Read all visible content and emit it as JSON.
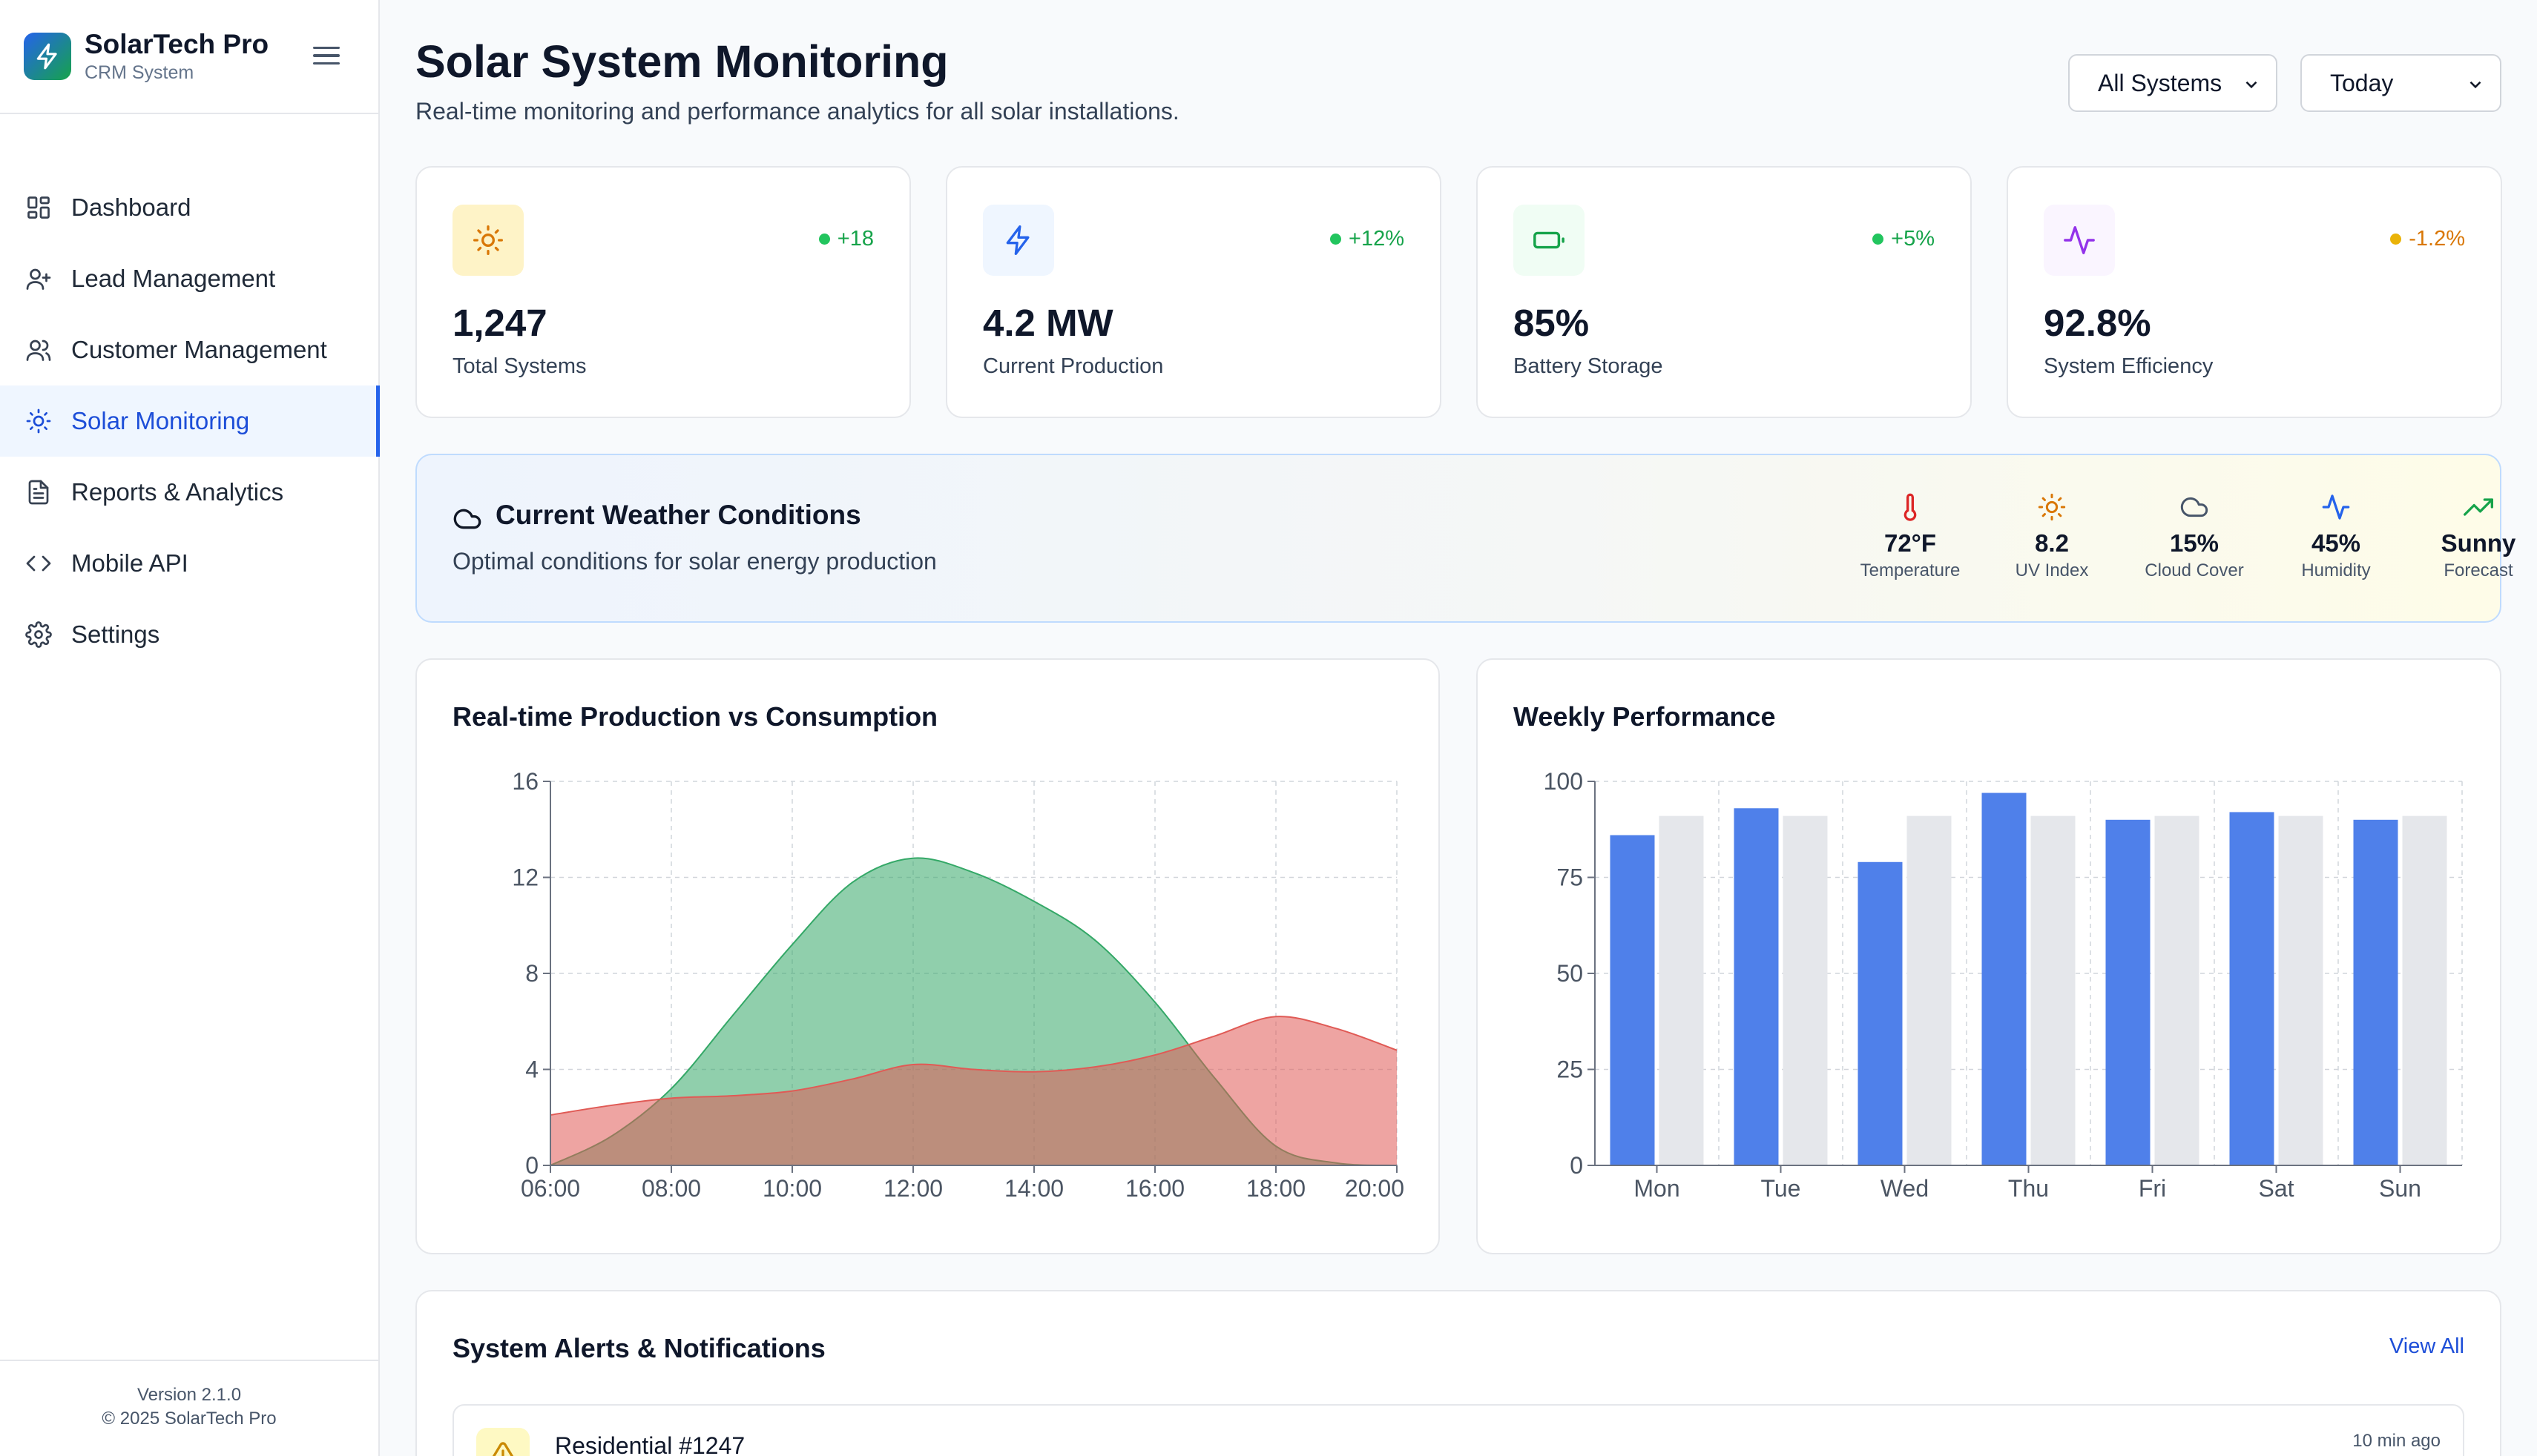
{
  "brand": {
    "name": "SolarTech Pro",
    "subtitle": "CRM System"
  },
  "sidebar": {
    "items": [
      {
        "label": "Dashboard",
        "icon": "dashboard-icon",
        "active": false
      },
      {
        "label": "Lead Management",
        "icon": "user-plus-icon",
        "active": false
      },
      {
        "label": "Customer Management",
        "icon": "users-icon",
        "active": false
      },
      {
        "label": "Solar Monitoring",
        "icon": "sun-icon",
        "active": true
      },
      {
        "label": "Reports & Analytics",
        "icon": "file-text-icon",
        "active": false
      },
      {
        "label": "Mobile API",
        "icon": "code-icon",
        "active": false
      },
      {
        "label": "Settings",
        "icon": "gear-icon",
        "active": false
      }
    ],
    "version": "Version 2.1.0",
    "copyright": "© 2025 SolarTech Pro"
  },
  "header": {
    "title": "Solar System Monitoring",
    "subtitle": "Real-time monitoring and performance analytics for all solar installations.",
    "system_filter": "All Systems",
    "time_filter": "Today"
  },
  "stats": [
    {
      "value": "1,247",
      "label": "Total Systems",
      "delta": "+18",
      "icon": "sun-icon",
      "accent": "#d97706",
      "delta_color": "#16a34a"
    },
    {
      "value": "4.2 MW",
      "label": "Current Production",
      "delta": "+12%",
      "icon": "lightning-icon",
      "accent": "#2563eb",
      "delta_color": "#16a34a"
    },
    {
      "value": "85%",
      "label": "Battery Storage",
      "delta": "+5%",
      "icon": "battery-icon",
      "accent": "#16a34a",
      "delta_color": "#16a34a"
    },
    {
      "value": "92.8%",
      "label": "System Efficiency",
      "delta": "-1.2%",
      "icon": "activity-icon",
      "accent": "#9333ea",
      "delta_color": "#d97706"
    }
  ],
  "weather": {
    "title": "Current Weather Conditions",
    "subtitle": "Optimal conditions for solar energy production",
    "metrics": [
      {
        "value": "72°F",
        "label": "Temperature",
        "icon": "thermometer-icon",
        "color": "#dc2626"
      },
      {
        "value": "8.2",
        "label": "UV Index",
        "icon": "sun-icon",
        "color": "#d97706"
      },
      {
        "value": "15%",
        "label": "Cloud Cover",
        "icon": "cloud-icon",
        "color": "#475569"
      },
      {
        "value": "45%",
        "label": "Humidity",
        "icon": "activity-icon",
        "color": "#2563eb"
      },
      {
        "value": "Sunny",
        "label": "Forecast",
        "icon": "trending-up-icon",
        "color": "#16a34a"
      }
    ]
  },
  "charts": {
    "production_title": "Real-time Production vs Consumption",
    "weekly_title": "Weekly Performance"
  },
  "chart_data": [
    {
      "type": "area",
      "title": "Real-time Production vs Consumption",
      "x": [
        "06:00",
        "07:00",
        "08:00",
        "09:00",
        "10:00",
        "11:00",
        "12:00",
        "13:00",
        "14:00",
        "15:00",
        "16:00",
        "17:00",
        "18:00",
        "19:00",
        "20:00"
      ],
      "x_ticks": [
        "06:00",
        "08:00",
        "10:00",
        "12:00",
        "14:00",
        "16:00",
        "18:00",
        "20:00"
      ],
      "ylim": [
        0,
        16
      ],
      "y_ticks": [
        0,
        4,
        8,
        12,
        16
      ],
      "grid": true,
      "series": [
        {
          "values": [
            0,
            1.2,
            3.2,
            6.2,
            9.2,
            11.8,
            12.8,
            12.2,
            11.0,
            9.4,
            6.8,
            3.6,
            0.8,
            0.1,
            0
          ],
          "color": "#34a867"
        },
        {
          "values": [
            2.1,
            2.5,
            2.8,
            2.9,
            3.1,
            3.6,
            4.2,
            4.0,
            3.9,
            4.1,
            4.6,
            5.4,
            6.2,
            5.7,
            4.8
          ],
          "color": "#e05a55"
        }
      ]
    },
    {
      "type": "bar",
      "title": "Weekly Performance",
      "categories": [
        "Mon",
        "Tue",
        "Wed",
        "Thu",
        "Fri",
        "Sat",
        "Sun"
      ],
      "ylim": [
        0,
        100
      ],
      "y_ticks": [
        0,
        25,
        50,
        75,
        100
      ],
      "grid": true,
      "series": [
        {
          "values": [
            86,
            93,
            79,
            97,
            90,
            92,
            90
          ],
          "color": "#4f80ea"
        },
        {
          "values": [
            91,
            91,
            91,
            91,
            91,
            91,
            91
          ],
          "color": "#e5e7eb"
        }
      ]
    }
  ],
  "alerts": {
    "title": "System Alerts & Notifications",
    "view_all": "View All",
    "items": [
      {
        "name": "Residential #1247",
        "time": "10 min ago",
        "icon": "warning-icon"
      }
    ]
  }
}
